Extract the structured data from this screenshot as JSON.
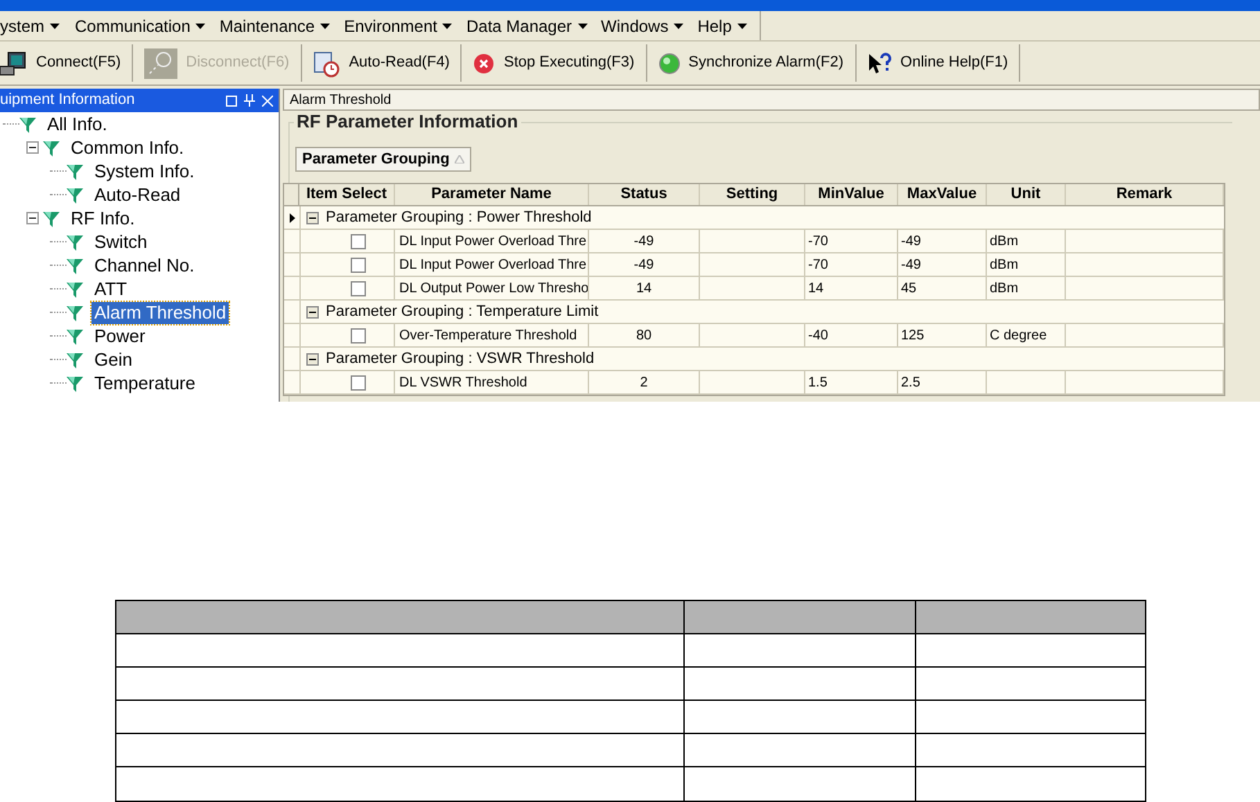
{
  "menu": [
    {
      "label": "ystem"
    },
    {
      "label": "Communication"
    },
    {
      "label": "Maintenance"
    },
    {
      "label": "Environment"
    },
    {
      "label": "Data Manager"
    },
    {
      "label": "Windows"
    },
    {
      "label": "Help"
    }
  ],
  "toolbar": [
    {
      "kind": "connect",
      "label": "Connect(F5)",
      "disabled": false
    },
    {
      "kind": "disconnect",
      "label": "Disconnect(F6)",
      "disabled": true
    },
    {
      "kind": "autoread",
      "label": "Auto-Read(F4)",
      "disabled": false
    },
    {
      "kind": "stop",
      "label": "Stop Executing(F3)",
      "disabled": false
    },
    {
      "kind": "sync",
      "label": "Synchronize Alarm(F2)",
      "disabled": false
    },
    {
      "kind": "help",
      "label": "Online Help(F1)",
      "disabled": false
    }
  ],
  "sidebar": {
    "title": "uipment Information",
    "tree": [
      {
        "label": "All Info.",
        "selected": false,
        "children": [
          {
            "label": "Common Info.",
            "selected": false,
            "expanded": true,
            "children": [
              {
                "label": "System Info.",
                "selected": false
              },
              {
                "label": "Auto-Read",
                "selected": false
              }
            ]
          },
          {
            "label": "RF Info.",
            "selected": false,
            "expanded": true,
            "children": [
              {
                "label": "Switch",
                "selected": false
              },
              {
                "label": "Channel No.",
                "selected": false
              },
              {
                "label": "ATT",
                "selected": false
              },
              {
                "label": "Alarm Threshold",
                "selected": true
              },
              {
                "label": "Power",
                "selected": false
              },
              {
                "label": "Gein",
                "selected": false
              },
              {
                "label": "Temperature",
                "selected": false
              }
            ]
          }
        ]
      }
    ]
  },
  "document_tab": "Alarm Threshold",
  "group_title": "RF Parameter Information",
  "grouping_button": "Parameter Grouping",
  "table": {
    "columns": [
      "Item Select",
      "Parameter Name",
      "Status",
      "Setting",
      "MinValue",
      "MaxValue",
      "Unit",
      "Remark"
    ],
    "rows": [
      {
        "kind": "group",
        "label": "Parameter Grouping : Power Threshold",
        "current": true
      },
      {
        "kind": "item",
        "checked": false,
        "cells": [
          "DL Input Power Overload Thre",
          "-49",
          "",
          "-70",
          "-49",
          "dBm",
          ""
        ]
      },
      {
        "kind": "item",
        "checked": false,
        "cells": [
          "DL Input Power Overload Thre",
          "-49",
          "",
          "-70",
          "-49",
          "dBm",
          ""
        ]
      },
      {
        "kind": "item",
        "checked": false,
        "cells": [
          "DL Output Power Low Thresho",
          "14",
          "",
          "14",
          "45",
          "dBm",
          ""
        ]
      },
      {
        "kind": "group",
        "label": "Parameter Grouping : Temperature Limit",
        "current": false
      },
      {
        "kind": "item",
        "checked": false,
        "cells": [
          "Over-Temperature Threshold",
          "80",
          "",
          "-40",
          "125",
          "C degree",
          ""
        ]
      },
      {
        "kind": "group",
        "label": "Parameter Grouping : VSWR Threshold",
        "current": false
      },
      {
        "kind": "item",
        "checked": false,
        "cells": [
          "DL VSWR Threshold",
          "2",
          "",
          "1.5",
          "2.5",
          "",
          ""
        ]
      }
    ]
  }
}
